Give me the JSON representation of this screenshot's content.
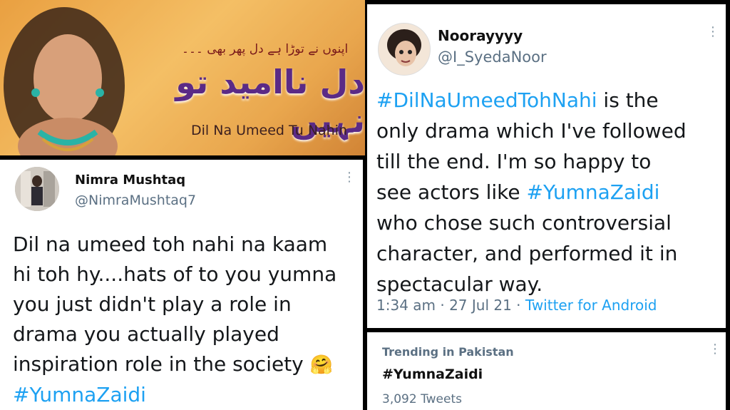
{
  "banner": {
    "urdu_tagline": "اپنوں نے توڑا ہے دل پھر بھی ۔۔۔",
    "urdu_title": "دل ناامید تو نہیں",
    "english_title": "Dil Na Umeed Tu Nahin"
  },
  "tweet_left": {
    "name": "Nimra Mushtaq",
    "handle": "@NimraMushtaq7",
    "text_lines": [
      "Dil na umeed toh nahi na kaam",
      "hi toh hy....hats of to you yumna",
      "you just didn't play a role in",
      "drama you actually played",
      "inspiration role in the society"
    ],
    "emoji": "🤗",
    "hashtag": "#YumnaZaidi"
  },
  "tweet_right": {
    "name": "Noorayyyy",
    "handle": "@I_SyedaNoor",
    "hashtag1": "#DilNaUmeedTohNahi",
    "line1_rest": " is the",
    "line2": "only drama which I've followed",
    "line3": "till the end. I'm so happy to",
    "line4_pre": "see actors like ",
    "hashtag2": "#YumnaZaidi",
    "line5": "who chose such controversial",
    "line6": "character, and performed it in",
    "line7": "spectacular way.",
    "time_date": "1:34 am · 27 Jul 21 · ",
    "source": "Twitter for Android"
  },
  "trending": {
    "label": "Trending in Pakistan",
    "tag": "#YumnaZaidi",
    "count": "3,092 Tweets"
  },
  "colors": {
    "link": "#1da1f2",
    "muted": "#5b7083"
  }
}
